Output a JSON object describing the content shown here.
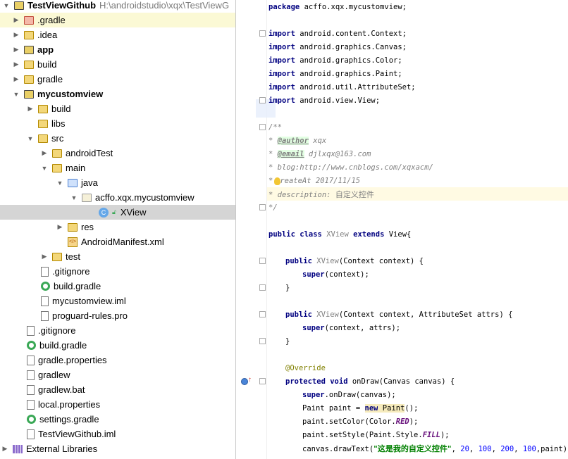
{
  "project_tree": {
    "root": {
      "name": "TestViewGithub",
      "path": "H:\\androidstudio\\xqx\\TestViewG"
    },
    "items": [
      {
        "label": ".gradle"
      },
      {
        "label": ".idea"
      },
      {
        "label": "app"
      },
      {
        "label": "build"
      },
      {
        "label": "gradle"
      },
      {
        "label": "mycustomview"
      },
      {
        "label": "build"
      },
      {
        "label": "libs"
      },
      {
        "label": "src"
      },
      {
        "label": "androidTest"
      },
      {
        "label": "main"
      },
      {
        "label": "java"
      },
      {
        "label": "acffo.xqx.mycustomview"
      },
      {
        "label": "XView"
      },
      {
        "label": "res"
      },
      {
        "label": "AndroidManifest.xml"
      },
      {
        "label": "test"
      },
      {
        "label": ".gitignore"
      },
      {
        "label": "build.gradle"
      },
      {
        "label": "mycustomview.iml"
      },
      {
        "label": "proguard-rules.pro"
      },
      {
        "label": ".gitignore"
      },
      {
        "label": "build.gradle"
      },
      {
        "label": "gradle.properties"
      },
      {
        "label": "gradlew"
      },
      {
        "label": "gradlew.bat"
      },
      {
        "label": "local.properties"
      },
      {
        "label": "settings.gradle"
      },
      {
        "label": "TestViewGithub.iml"
      },
      {
        "label": "External Libraries"
      }
    ]
  },
  "code": {
    "pkg_kw": "package",
    "pkg_name": " acffo.xqx.mycustomview;",
    "imp_kw": "import",
    "imports": [
      " android.content.Context;",
      " android.graphics.Canvas;",
      " android.graphics.Color;",
      " android.graphics.Paint;",
      " android.util.AttributeSet;",
      " android.view.View;"
    ],
    "doc_open": "/**",
    "doc_star": "* ",
    "author_tag": "@author",
    "author_val": " xqx",
    "email_tag": "@email",
    "email_val": " djlxqx@163.com",
    "blog": "* blog:http://www.cnblogs.com/xqxacm/",
    "create_star": "*",
    "create": "reateAt 2017/11/15",
    "desc_label": "* description: ",
    "desc_text": "自定义控件",
    "doc_close": "*/",
    "public_kw": "public",
    "class_kw": "class",
    "class_name": "XView",
    "extends_kw": "extends",
    "parent_decl": " View{",
    "ctor1_sig": "(Context context) {",
    "super_kw": "super",
    "ctor1_body": "(context);",
    "close_brace": "}",
    "ctor2_sig": "(Context context, AttributeSet attrs) {",
    "ctor2_body": "(context, attrs);",
    "override": "@Override",
    "protected_kw": "protected",
    "void_kw": "void",
    "ondraw_sig": " onDraw(Canvas canvas) {",
    "super_ondraw": ".onDraw(canvas);",
    "paint_decl": "Paint paint = ",
    "new_kw": "new",
    "paint_ctor": " Paint",
    "paint_ctor_end": "();",
    "setcolor_a": "paint.setColor(Color.",
    "red": "RED",
    "paren_end": ");",
    "setstyle_a": "paint.setStyle(Paint.Style.",
    "fill": "FILL",
    "draw_a": "canvas.drawText(",
    "draw_str": "\"这是我的自定义控件\"",
    "comma": ", ",
    "n20": "20",
    "n100": "100",
    "n200": "200",
    "draw_end": ",paint);"
  }
}
